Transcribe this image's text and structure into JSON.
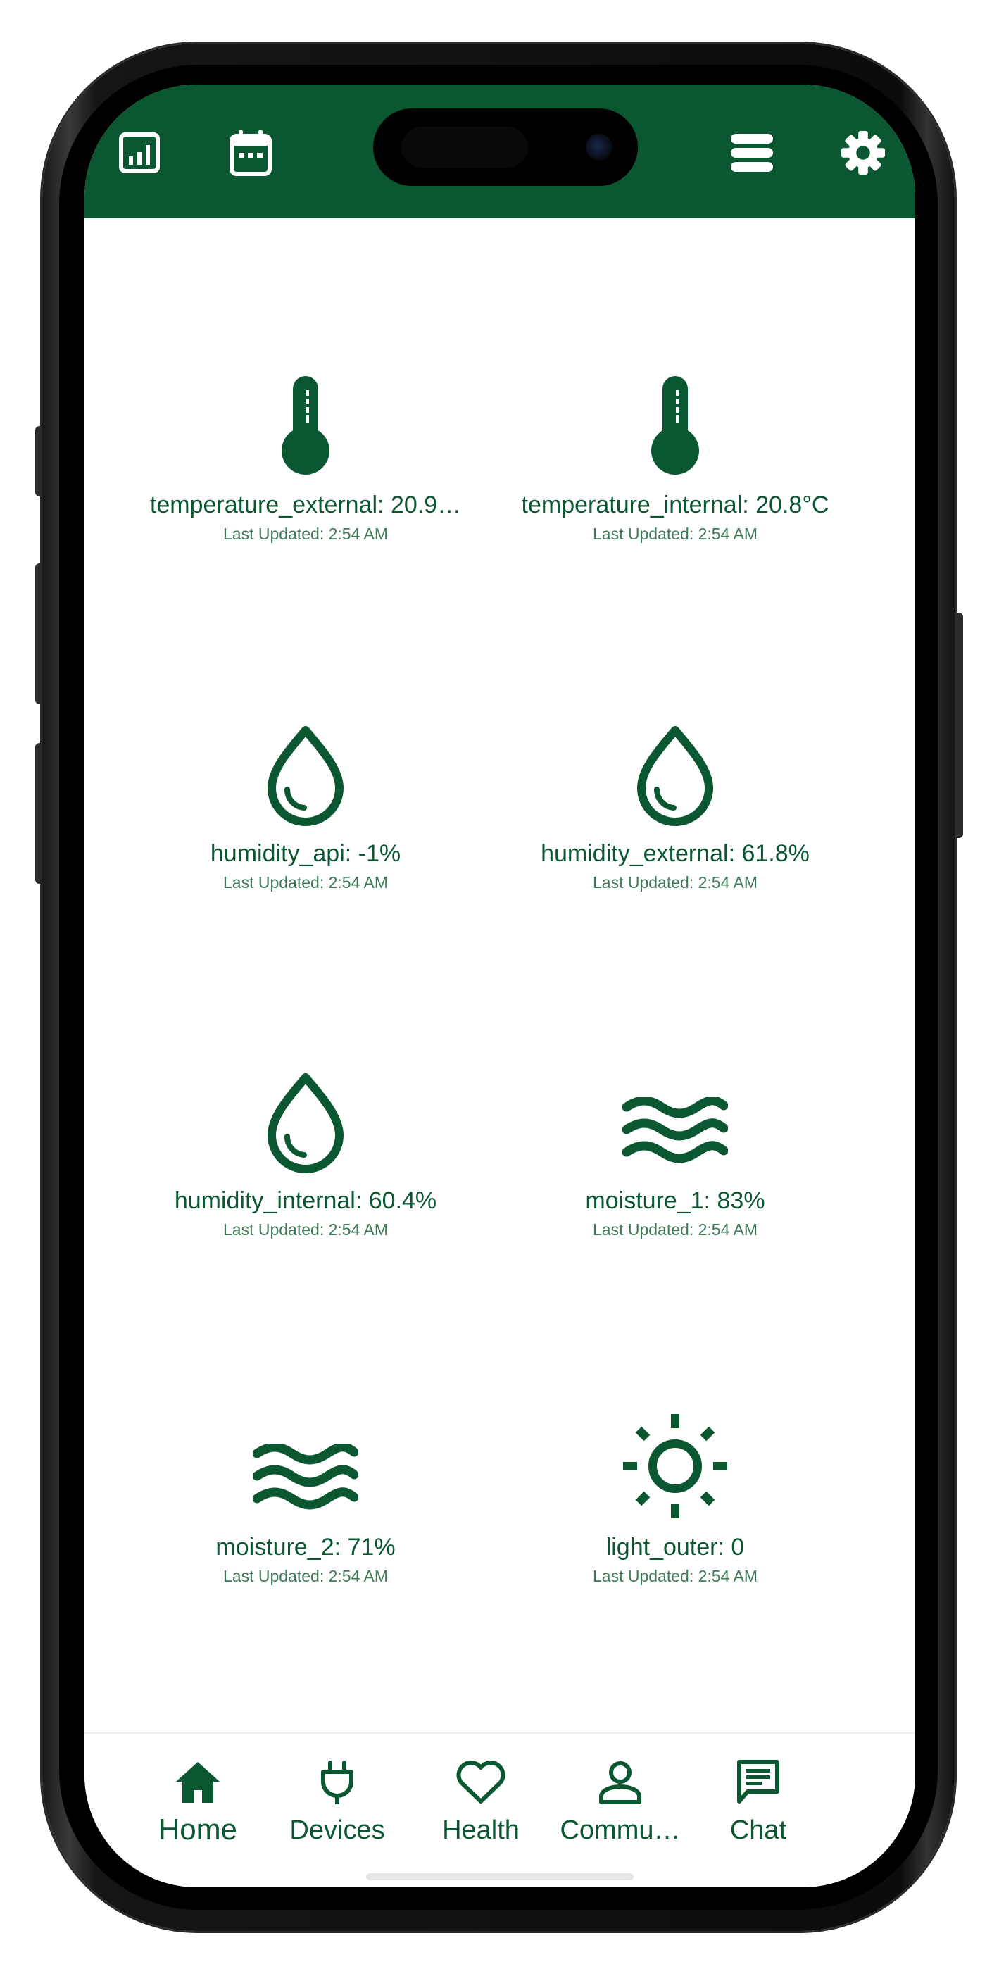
{
  "colors": {
    "brand_green": "#0b5731",
    "background": "#ffffff"
  },
  "topbar": {
    "left_icons": [
      "chart-icon",
      "calendar-icon"
    ],
    "right_icons": [
      "stack-icon",
      "gear-icon"
    ]
  },
  "sensors": [
    {
      "icon": "thermometer-icon",
      "value": "temperature_external: 20.9…",
      "updated": "Last Updated: 2:54 AM"
    },
    {
      "icon": "thermometer-icon",
      "value": "temperature_internal: 20.8°C",
      "updated": "Last Updated: 2:54 AM"
    },
    {
      "icon": "droplet-icon",
      "value": "humidity_api: -1%",
      "updated": "Last Updated: 2:54 AM"
    },
    {
      "icon": "droplet-icon",
      "value": "humidity_external: 61.8%",
      "updated": "Last Updated: 2:54 AM"
    },
    {
      "icon": "droplet-icon",
      "value": "humidity_internal: 60.4%",
      "updated": "Last Updated: 2:54 AM"
    },
    {
      "icon": "waves-icon",
      "value": "moisture_1: 83%",
      "updated": "Last Updated: 2:54 AM"
    },
    {
      "icon": "waves-icon",
      "value": "moisture_2: 71%",
      "updated": "Last Updated: 2:54 AM"
    },
    {
      "icon": "sun-icon",
      "value": "light_outer: 0",
      "updated": "Last Updated: 2:54 AM"
    }
  ],
  "bottom_nav": {
    "items": [
      {
        "label": "Home",
        "icon": "home-icon",
        "active": true
      },
      {
        "label": "Devices",
        "icon": "plug-icon",
        "active": false
      },
      {
        "label": "Health",
        "icon": "heart-icon",
        "active": false
      },
      {
        "label": "Commu…",
        "icon": "person-icon",
        "active": false
      },
      {
        "label": "Chat",
        "icon": "chat-icon",
        "active": false
      }
    ]
  }
}
